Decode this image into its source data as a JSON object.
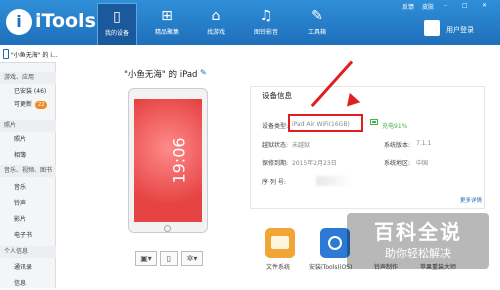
{
  "app": {
    "name": "iTools"
  },
  "nav": [
    {
      "label": "我的设备",
      "icon": "phone-icon",
      "active": true
    },
    {
      "label": "精品聚集",
      "icon": "grid-icon"
    },
    {
      "label": "找游戏",
      "icon": "gamepad-icon"
    },
    {
      "label": "图铃影音",
      "icon": "music-icon"
    },
    {
      "label": "工具箱",
      "icon": "wrench-icon"
    }
  ],
  "topright": {
    "feedback": "反馈",
    "skin": "皮肤",
    "user_center": "用户登录"
  },
  "sidebar": {
    "device_name": "\"小鱼无海\" 的 i...",
    "sections": [
      {
        "title": "游戏、应用",
        "items": [
          {
            "label": "已安装 (46)"
          },
          {
            "label": "可更新",
            "badge": "22"
          }
        ]
      },
      {
        "title": "照片",
        "items": [
          {
            "label": "照片"
          },
          {
            "label": "相簿"
          }
        ]
      },
      {
        "title": "音乐、视频、图书",
        "items": [
          {
            "label": "音乐"
          },
          {
            "label": "铃声"
          },
          {
            "label": "影片"
          },
          {
            "label": "电子书"
          }
        ]
      },
      {
        "title": "个人信息",
        "items": [
          {
            "label": "通讯录"
          },
          {
            "label": "信息"
          }
        ]
      }
    ]
  },
  "device": {
    "title": "\"小鱼无海\" 的 iPad",
    "screen_time": "19:06"
  },
  "info": {
    "title": "设备信息",
    "type_label": "设备类型:",
    "type_value": "iPad Air WiFi(16GB)",
    "battery_value": "充电91%",
    "jailbreak_label": "越狱状态:",
    "jailbreak_value": "未越狱",
    "version_label": "系统版本:",
    "version_value": "7.1.1",
    "warranty_label": "保修到期:",
    "warranty_value": "2015年2月23日",
    "region_label": "系统地区:",
    "region_value": "中国",
    "serial_label": "序 列 号:",
    "more": "更多详情"
  },
  "tools": [
    {
      "label": "文件系统",
      "color": "#f0a534",
      "icon": "folder-icon"
    },
    {
      "label": "安装iTools(iOS)",
      "color": "#2d7ad6",
      "icon": "app-icon"
    },
    {
      "label": "铃声制作",
      "color": "#ffffff",
      "icon": "bell-icon"
    },
    {
      "label": "苹果重装大师",
      "color": "#ffffff",
      "icon": "restore-icon"
    }
  ],
  "watermark": {
    "main": "百科全说",
    "sub": "助你轻松解决"
  }
}
